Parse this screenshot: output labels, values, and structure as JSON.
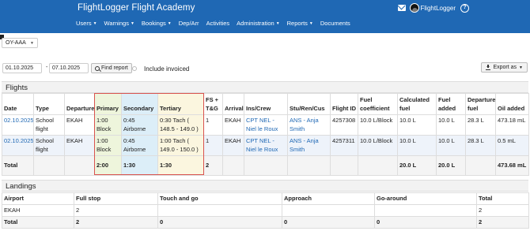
{
  "header": {
    "brand": "FlightLogger Flight Academy",
    "user": "FlightLogger",
    "nav": [
      "Users",
      "Warnings",
      "Bookings",
      "Dep/Arr",
      "Activities",
      "Administration",
      "Reports",
      "Documents"
    ],
    "nav_has_caret": [
      true,
      true,
      true,
      false,
      false,
      true,
      true,
      false
    ],
    "brand_color": "#1f68b4"
  },
  "aircraft": {
    "selected": "OY-AAA"
  },
  "filters": {
    "date_from": "01.10.2025",
    "separator": "-",
    "date_to": "07.10.2025",
    "find_label": "Find report",
    "invoiced_label": "Include invoiced",
    "invoiced_checked": false,
    "export_label": "Export as"
  },
  "flights": {
    "title": "Flights",
    "columns": [
      "Date",
      "Type",
      "Departure",
      "Primary",
      "Secondary",
      "Tertiary",
      "FS + T&G",
      "Arrival",
      "Ins/Crew",
      "Stu/Ren/Cus",
      "Flight ID",
      "Fuel coefficient",
      "Calculated fuel",
      "Fuel added",
      "Departure fuel",
      "Oil added"
    ],
    "rows": [
      {
        "date": "02.10.2025",
        "type": "School flight",
        "departure": "EKAH",
        "primary": "1:00 Block",
        "secondary": "0:45 Airborne",
        "tertiary": "0:30 Tach ( 148.5 - 149.0 )",
        "fs": "1",
        "arrival": "EKAH",
        "crew": "CPT NEL - Niel le Roux",
        "student": "ANS - Anja Smith",
        "flight_id": "4257308",
        "coefficient": "10.0 L/Block",
        "calc_fuel": "10.0 L",
        "fuel_added": "10.0 L",
        "dep_fuel": "28.3 L",
        "oil": "473.18 mL"
      },
      {
        "date": "02.10.2025",
        "type": "School flight",
        "departure": "EKAH",
        "primary": "1:00 Block",
        "secondary": "0:45 Airborne",
        "tertiary": "1:00 Tach ( 149.0 - 150.0 )",
        "fs": "1",
        "arrival": "EKAH",
        "crew": "CPT NEL - Niel le Roux",
        "student": "ANS - Anja Smith",
        "flight_id": "4257311",
        "coefficient": "10.0 L/Block",
        "calc_fuel": "10.0 L",
        "fuel_added": "10.0 L",
        "dep_fuel": "28.3 L",
        "oil": "0.5 mL"
      }
    ],
    "total": {
      "label": "Total",
      "primary": "2:00",
      "secondary": "1:30",
      "tertiary": "1:30",
      "fs": "2",
      "calc_fuel": "20.0 L",
      "fuel_added": "20.0 L",
      "oil": "473.68 mL"
    }
  },
  "landings": {
    "title": "Landings",
    "columns": [
      "Airport",
      "Full stop",
      "Touch and go",
      "Approach",
      "Go-around",
      "Total"
    ],
    "rows": [
      {
        "airport": "EKAH",
        "full_stop": "2",
        "touch_go": "",
        "approach": "",
        "go_around": "",
        "total": "2"
      }
    ],
    "total": {
      "label": "Total",
      "full_stop": "2",
      "touch_go": "0",
      "approach": "0",
      "go_around": "0",
      "total": "2"
    }
  }
}
